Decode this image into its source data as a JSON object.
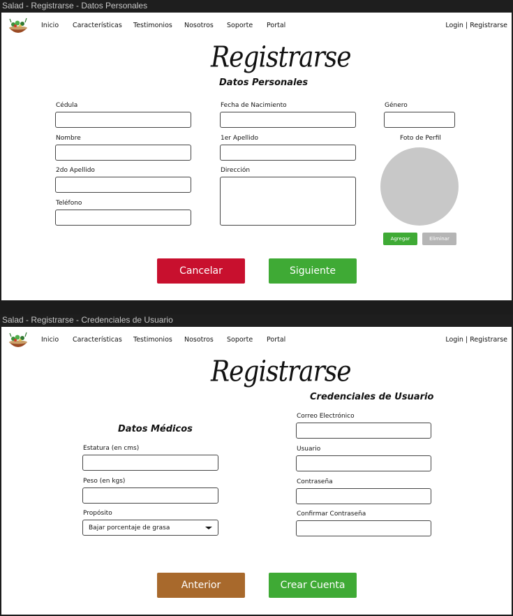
{
  "colors": {
    "cancel": "#c8102e",
    "next": "#3faa35",
    "previous": "#a8692c",
    "create": "#3faa35",
    "add": "#3faa35",
    "remove": "#b5b5b5",
    "avatar": "#c8c8c8"
  },
  "nav": {
    "items": [
      "Inicio",
      "Características",
      "Testimonios",
      "Nosotros",
      "Soporte",
      "Portal"
    ],
    "login": "Login",
    "separator": " | ",
    "register": "Registrarse"
  },
  "screen1": {
    "window_title": "Salad - Registrarse - Datos Personales",
    "title": "Registrarse",
    "subtitle": "Datos Personales",
    "fields": {
      "cedula": "Cédula",
      "fecha": "Fecha de Nacimiento",
      "genero": "Género",
      "nombre": "Nombre",
      "apellido1": "1er Apellido",
      "apellido2": "2do Apellido",
      "direccion": "Dirección",
      "telefono": "Teléfono"
    },
    "photo_label": "Foto de Perfil",
    "add_button": "Agregar",
    "remove_button": "Eliminar",
    "cancel_button": "Cancelar",
    "next_button": "Siguiente"
  },
  "screen2": {
    "window_title": "Salad - Registrarse - Credenciales de Usuario",
    "title": "Registrarse",
    "credentials_title": "Credenciales de Usuario",
    "medical_title": "Datos Médicos",
    "fields": {
      "estatura": "Estatura (en cms)",
      "peso": "Peso (en kgs)",
      "proposito": "Propósito",
      "correo": "Correo Electrónico",
      "usuario": "Usuario",
      "contrasena": "Contraseña",
      "confirmar": "Confirmar Contraseña"
    },
    "purpose_value": "Bajar porcentaje de grasa",
    "previous_button": "Anterior",
    "create_button": "Crear Cuenta"
  }
}
